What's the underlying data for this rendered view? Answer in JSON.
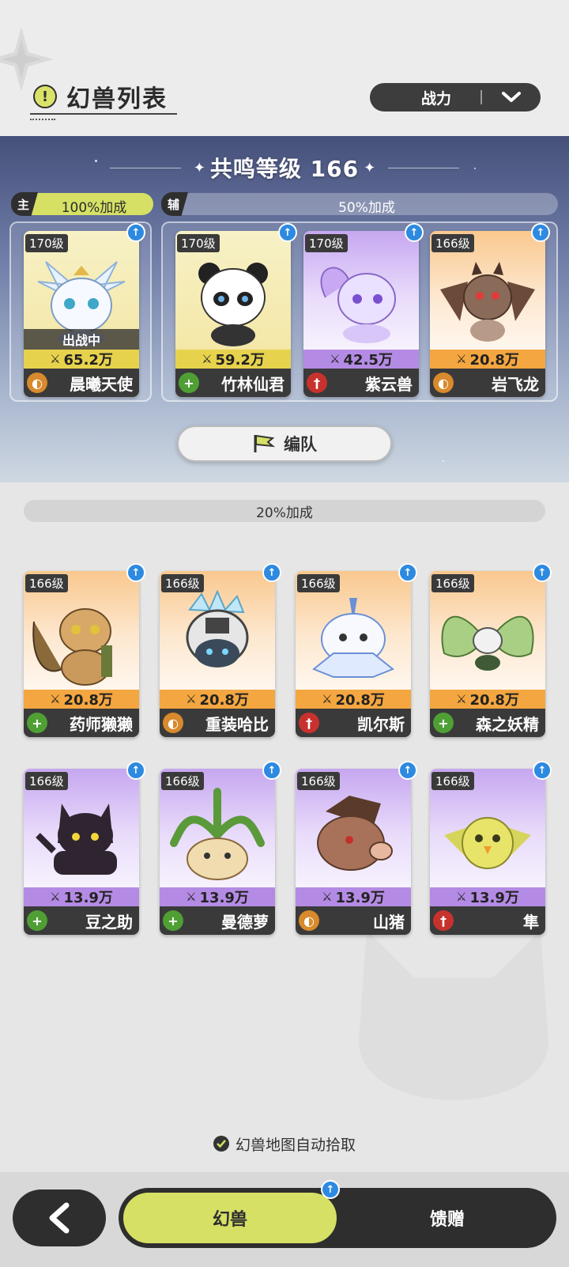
{
  "header": {
    "title": "幻兽列表",
    "sort": {
      "label": "战力"
    }
  },
  "resonance": {
    "title": "共鸣等级 166",
    "main": {
      "tag": "主",
      "bonus": "100%加成"
    },
    "support": {
      "tag": "辅",
      "bonus": "50%加成"
    },
    "team_button": "编队"
  },
  "main_pet": {
    "level": "170级",
    "power": "65.2万",
    "name": "晨曦天使",
    "role": "tank",
    "in_battle_label": "出战中"
  },
  "support_pets": [
    {
      "level": "170级",
      "power": "59.2万",
      "name": "竹林仙君",
      "role": "support"
    },
    {
      "level": "170级",
      "power": "42.5万",
      "name": "紫云兽",
      "role": "attack"
    },
    {
      "level": "166级",
      "power": "20.8万",
      "name": "岩飞龙",
      "role": "tank"
    }
  ],
  "bench": {
    "bonus": "20%加成",
    "rows": [
      [
        {
          "level": "166级",
          "power": "20.8万",
          "name": "药师獭獭",
          "role": "support"
        },
        {
          "level": "166级",
          "power": "20.8万",
          "name": "重装哈比",
          "role": "tank"
        },
        {
          "level": "166级",
          "power": "20.8万",
          "name": "凯尔斯",
          "role": "attack"
        },
        {
          "level": "166级",
          "power": "20.8万",
          "name": "森之妖精",
          "role": "support"
        }
      ],
      [
        {
          "level": "166级",
          "power": "13.9万",
          "name": "豆之助",
          "role": "support"
        },
        {
          "level": "166级",
          "power": "13.9万",
          "name": "曼德萝",
          "role": "support"
        },
        {
          "level": "166级",
          "power": "13.9万",
          "name": "山猪",
          "role": "tank"
        },
        {
          "level": "166级",
          "power": "13.9万",
          "name": "隼",
          "role": "attack"
        }
      ]
    ]
  },
  "auto_pick": {
    "label": "幻兽地图自动拾取",
    "checked": true
  },
  "bottom_nav": {
    "tabs": [
      {
        "label": "幻兽",
        "active": true
      },
      {
        "label": "馈赠",
        "active": false
      }
    ]
  },
  "colors": {
    "accent": "#d6e065",
    "dark": "#2e2e2e",
    "gold_card": "#e7d24d",
    "orange_card": "#f4a640",
    "purple_card": "#b48be4",
    "support_role": "#4f9f35",
    "tank_role": "#d88a2c",
    "attack_role": "#c8322e",
    "upgrade": "#2d8ae0"
  }
}
